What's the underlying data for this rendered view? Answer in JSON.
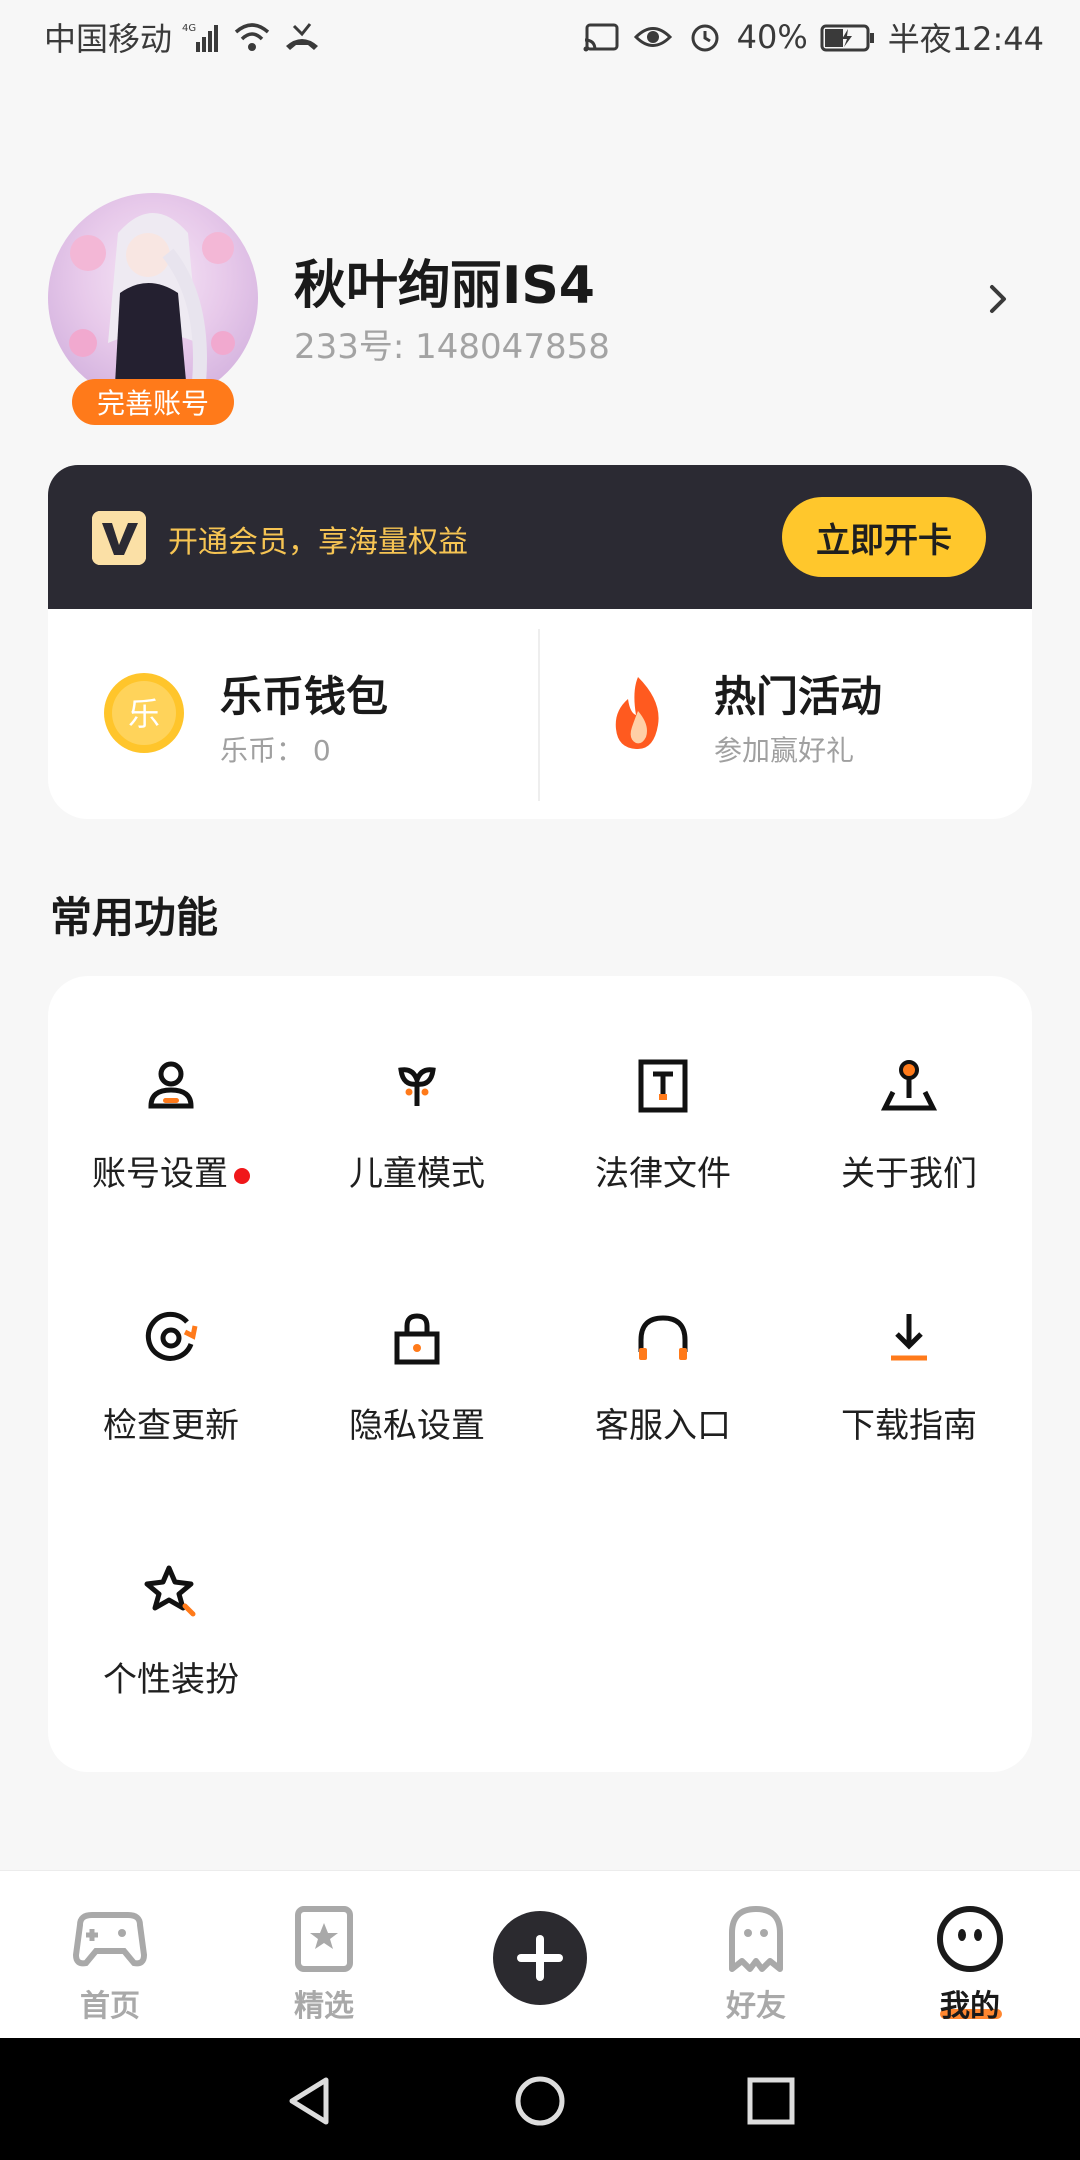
{
  "status_bar": {
    "carrier": "中国移动",
    "battery": "40%",
    "time": "半夜12:44"
  },
  "profile": {
    "nickname": "秋叶绚丽IS4",
    "uid": "233号: 148047858",
    "complete_badge": "完善账号"
  },
  "vip": {
    "text": "开通会员，享海量权益",
    "button": "立即开卡"
  },
  "wallet": {
    "coin_title": "乐币钱包",
    "coin_sub": "乐币： 0",
    "activity_title": "热门活动",
    "activity_sub": "参加赢好礼"
  },
  "functions": {
    "section_title": "常用功能",
    "items": [
      {
        "label": "账号设置",
        "icon": "account-settings-icon"
      },
      {
        "label": "儿童模式",
        "icon": "kids-mode-icon"
      },
      {
        "label": "法律文件",
        "icon": "legal-document-icon"
      },
      {
        "label": "关于我们",
        "icon": "about-us-icon"
      },
      {
        "label": "检查更新",
        "icon": "check-update-icon"
      },
      {
        "label": "隐私设置",
        "icon": "privacy-lock-icon"
      },
      {
        "label": "客服入口",
        "icon": "headset-icon"
      },
      {
        "label": "下载指南",
        "icon": "download-icon"
      },
      {
        "label": "个性装扮",
        "icon": "star-customize-icon"
      }
    ]
  },
  "bottom_nav": {
    "home": "首页",
    "featured": "精选",
    "friends": "好友",
    "mine": "我的"
  },
  "colors": {
    "accent_orange": "#ff7a1a",
    "vip_dark": "#2b2a33",
    "vip_gold": "#ffc72c",
    "red_dot": "#f0171a"
  }
}
